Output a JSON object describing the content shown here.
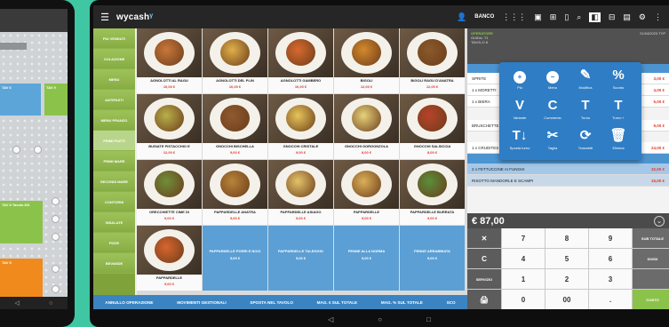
{
  "left_tablet": {
    "blocks": [
      {
        "label": "TAV 6"
      },
      {
        "label": "TAV 9"
      },
      {
        "label": "TAV 8\nTavolo 8/3"
      },
      {
        "label": "TAV 5"
      }
    ]
  },
  "topbar": {
    "menu_icon": "hamburger-icon",
    "logo": "wycash",
    "banco": "BANCO",
    "icons": [
      "user-icon",
      "grid-icon",
      "table-icon",
      "gift-icon",
      "phone-icon",
      "search-icon",
      "square-icon",
      "calc-icon",
      "chart-icon",
      "gear-icon",
      "more-icon"
    ]
  },
  "categories": [
    {
      "label": "PIU VENDUTI"
    },
    {
      "label": "COLAZIONE"
    },
    {
      "label": "MENU"
    },
    {
      "label": "ANTIPASTI"
    },
    {
      "label": "MENU PRANZO"
    },
    {
      "label": "PRIMI PIATTI"
    },
    {
      "label": "PRIMI MARE"
    },
    {
      "label": "SECONDI MARE"
    },
    {
      "label": "CONTORNI"
    },
    {
      "label": "INSALATE"
    },
    {
      "label": "PIZZE"
    },
    {
      "label": "BEVANDE"
    }
  ],
  "products": [
    {
      "name": "AGNOLOTTI AL RAGU",
      "price": "10,00 €",
      "color": "#c8783a"
    },
    {
      "name": "AGNOLOTTI DEL PLIN",
      "price": "10,00 €",
      "color": "#e0b04a"
    },
    {
      "name": "AGNOLOTTI GAMBERO",
      "price": "10,00 €",
      "color": "#d9692e"
    },
    {
      "name": "BIGOLI",
      "price": "12,00 €",
      "color": "#d4892d"
    },
    {
      "name": "BIGOLI RAGU D'ANATRA",
      "price": "12,00 €",
      "color": "#8a5a2b"
    },
    {
      "name": "BUSIATE PISTACCHIO E",
      "price": "12,00 €",
      "color": "#b8b04a"
    },
    {
      "name": "GNOCCHI BISCHELLA",
      "price": "9,00 €",
      "color": "#8e5a30"
    },
    {
      "name": "GNOCCHI CRISTALE",
      "price": "9,00 €",
      "color": "#e6c45a"
    },
    {
      "name": "GNOCCHI GORGONZOLA",
      "price": "8,00 €",
      "color": "#e8d27a"
    },
    {
      "name": "GNOCCHI SALSICCIA",
      "price": "8,00 €",
      "color": "#b8432a"
    },
    {
      "name": "ORECCHIETTE CIME DI",
      "price": "9,00 €",
      "color": "#6f8e3a"
    },
    {
      "name": "PAPPARDELLE ANATRA",
      "price": "9,00 €",
      "color": "#b8843a"
    },
    {
      "name": "PAPPARDELLE ASIAGO",
      "price": "9,00 €",
      "color": "#e3c36a"
    },
    {
      "name": "PAPPARDELLE",
      "price": "9,00 €",
      "color": "#dbb058"
    },
    {
      "name": "PAPPARDELLE BURRATA",
      "price": "9,00 €",
      "color": "#5a8e3a"
    },
    {
      "name": "PAPPARDELLE",
      "price": "9,00 €",
      "color": "#d8652e"
    },
    {
      "name": "PAPPARDELLE PORRI E NOCI",
      "price": "9,00 €",
      "blue": true
    },
    {
      "name": "PAPPARDELLE TALEGGIO",
      "price": "9,00 €",
      "blue": true
    },
    {
      "name": "PENNE ALLA NORMA",
      "price": "9,00 €",
      "blue": true
    },
    {
      "name": "PENNE ARRABBIATA",
      "price": "9,00 €",
      "blue": true
    }
  ],
  "actions": [
    {
      "label": "ANNULLO OPERAZIONE"
    },
    {
      "label": "MOVIMENTI GESTIONALI"
    },
    {
      "label": "SPOSTA NEL TAVOLO"
    },
    {
      "label": "MAG. € SUL TOTALE"
    },
    {
      "label": "MAG. % SUL TOTALE"
    },
    {
      "label": "SCO"
    }
  ],
  "order": {
    "operator": "OPERATORE",
    "sub1": "GUIDA: T1",
    "sub2": "TAVOLO 8",
    "date": "21/04/2023 TYP",
    "rows": [
      {
        "name": "SPRITE",
        "price": "3,00 €"
      },
      {
        "name": "1 x MORETTI",
        "price": "4,00 €"
      },
      {
        "name": "1 x BIERA",
        "price": "5,00 €"
      },
      {
        "name": "BRUSCHETTE",
        "price": "9,00 €"
      },
      {
        "name": "1 x CRUDITES",
        "price": "24,00 €"
      }
    ],
    "turno2": "TURNO - 2",
    "sel_rows": [
      {
        "name": "2 x FETTUCCINE AI FUNGHI",
        "price": "32,00 €"
      },
      {
        "name": "RISOTTO MANDORLE E SCAMPI",
        "price": "15,00 €"
      }
    ],
    "total": "€ 87,00"
  },
  "popup": {
    "items": [
      {
        "icon": "+",
        "label": "Più"
      },
      {
        "icon": "−",
        "label": "Meno"
      },
      {
        "icon": "✎",
        "label": "Modifica"
      },
      {
        "icon": "%",
        "label": "Sconto"
      },
      {
        "icon": "V",
        "label": "Variante"
      },
      {
        "icon": "C",
        "label": "Commento"
      },
      {
        "icon": "T",
        "label": "Turno"
      },
      {
        "icon": "T",
        "label": "Turno +"
      },
      {
        "icon": "T↓",
        "label": "Sposta turno"
      },
      {
        "icon": "✂",
        "label": "Taglia"
      },
      {
        "icon": "⟳",
        "label": "Trasmetti"
      },
      {
        "icon": "🗑",
        "label": "Elimina"
      }
    ]
  },
  "keypad": {
    "keys": [
      "✕",
      "7",
      "8",
      "9",
      "SUB TOTALE",
      "C",
      "4",
      "5",
      "6",
      "DIVIDI",
      "SERVIZIO",
      "1",
      "2",
      "3",
      "",
      "🖨",
      "0",
      "00",
      ".",
      "CONTO"
    ]
  },
  "nav": {
    "back": "◁",
    "home": "○",
    "recent": "□"
  }
}
